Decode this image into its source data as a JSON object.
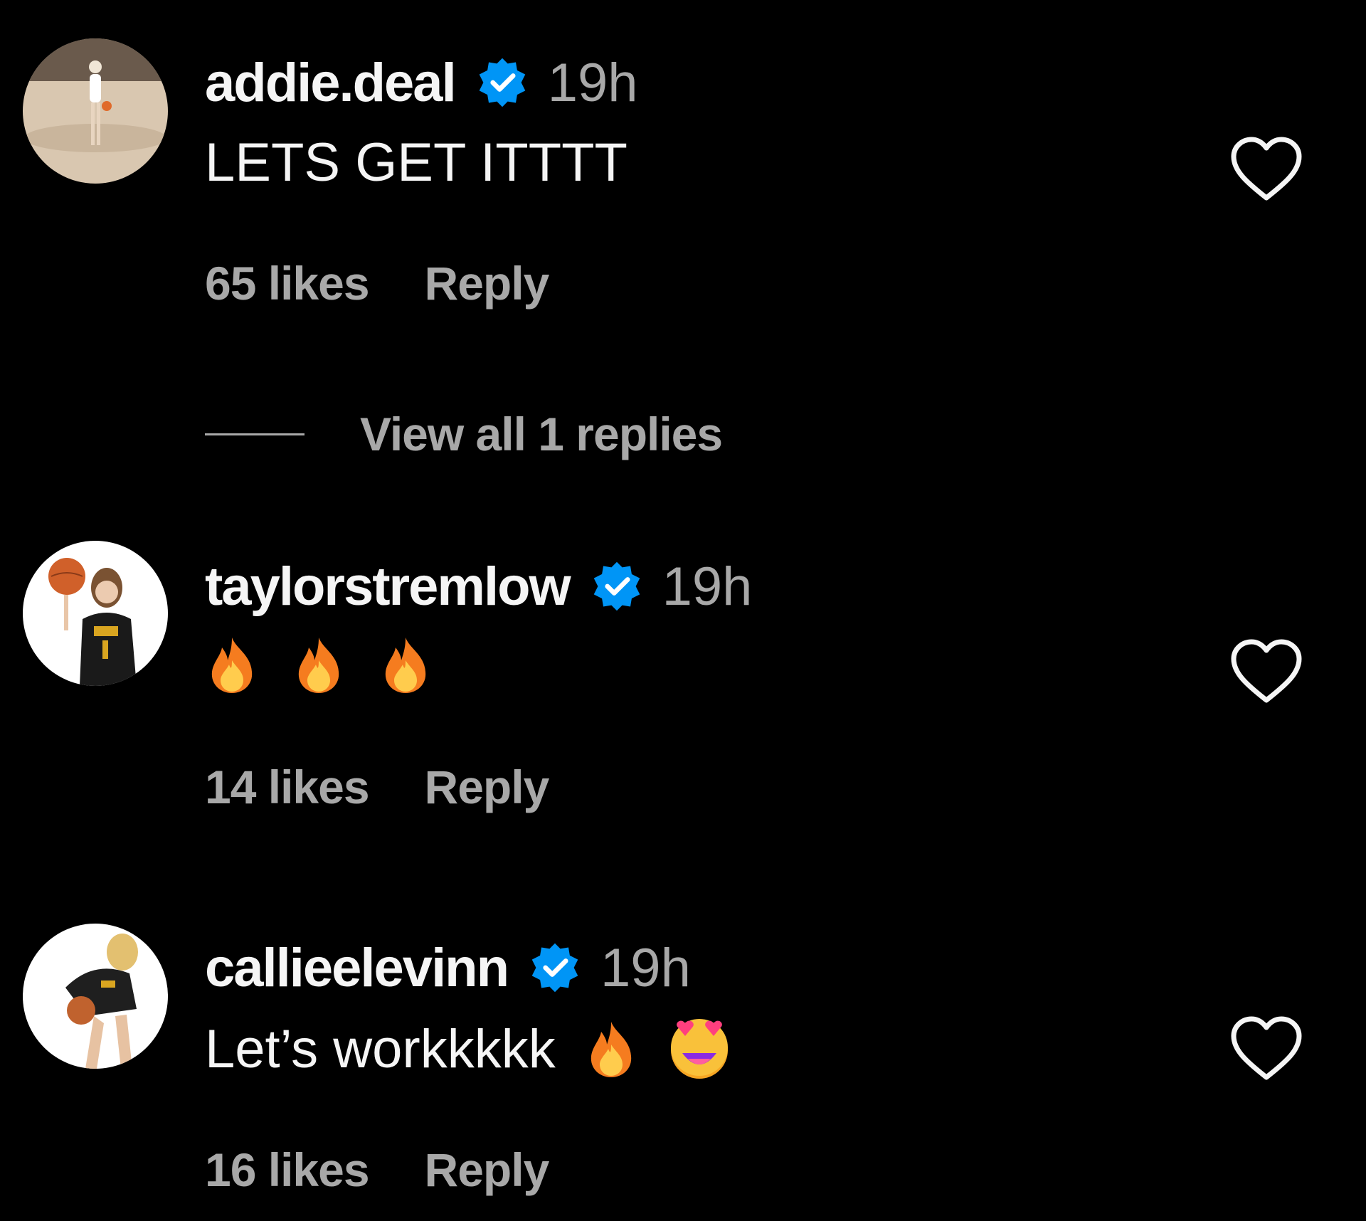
{
  "comments": [
    {
      "username": "addie.deal",
      "time": "19h",
      "text": "LETS GET ITTTT",
      "likes": "65 likes",
      "reply_label": "Reply",
      "view_replies": "View all 1 replies",
      "verified": true
    },
    {
      "username": "taylorstremlow",
      "time": "19h",
      "text": "",
      "emojis": [
        "fire",
        "fire",
        "fire"
      ],
      "likes": "14 likes",
      "reply_label": "Reply",
      "verified": true
    },
    {
      "username": "callieelevinn",
      "time": "19h",
      "text": "Let’s workkkkk",
      "emojis": [
        "fire",
        "heart-eyes"
      ],
      "likes": "16 likes",
      "reply_label": "Reply",
      "verified": true
    }
  ],
  "colors": {
    "background": "#000000",
    "primary_text": "#f5f5f5",
    "secondary_text": "#a8a8a8",
    "verified_blue": "#0095f6"
  },
  "icons": {
    "verified": "verified-badge-icon",
    "like": "heart-outline-icon",
    "fire": "fire-emoji",
    "heart_eyes": "heart-eyes-emoji"
  }
}
